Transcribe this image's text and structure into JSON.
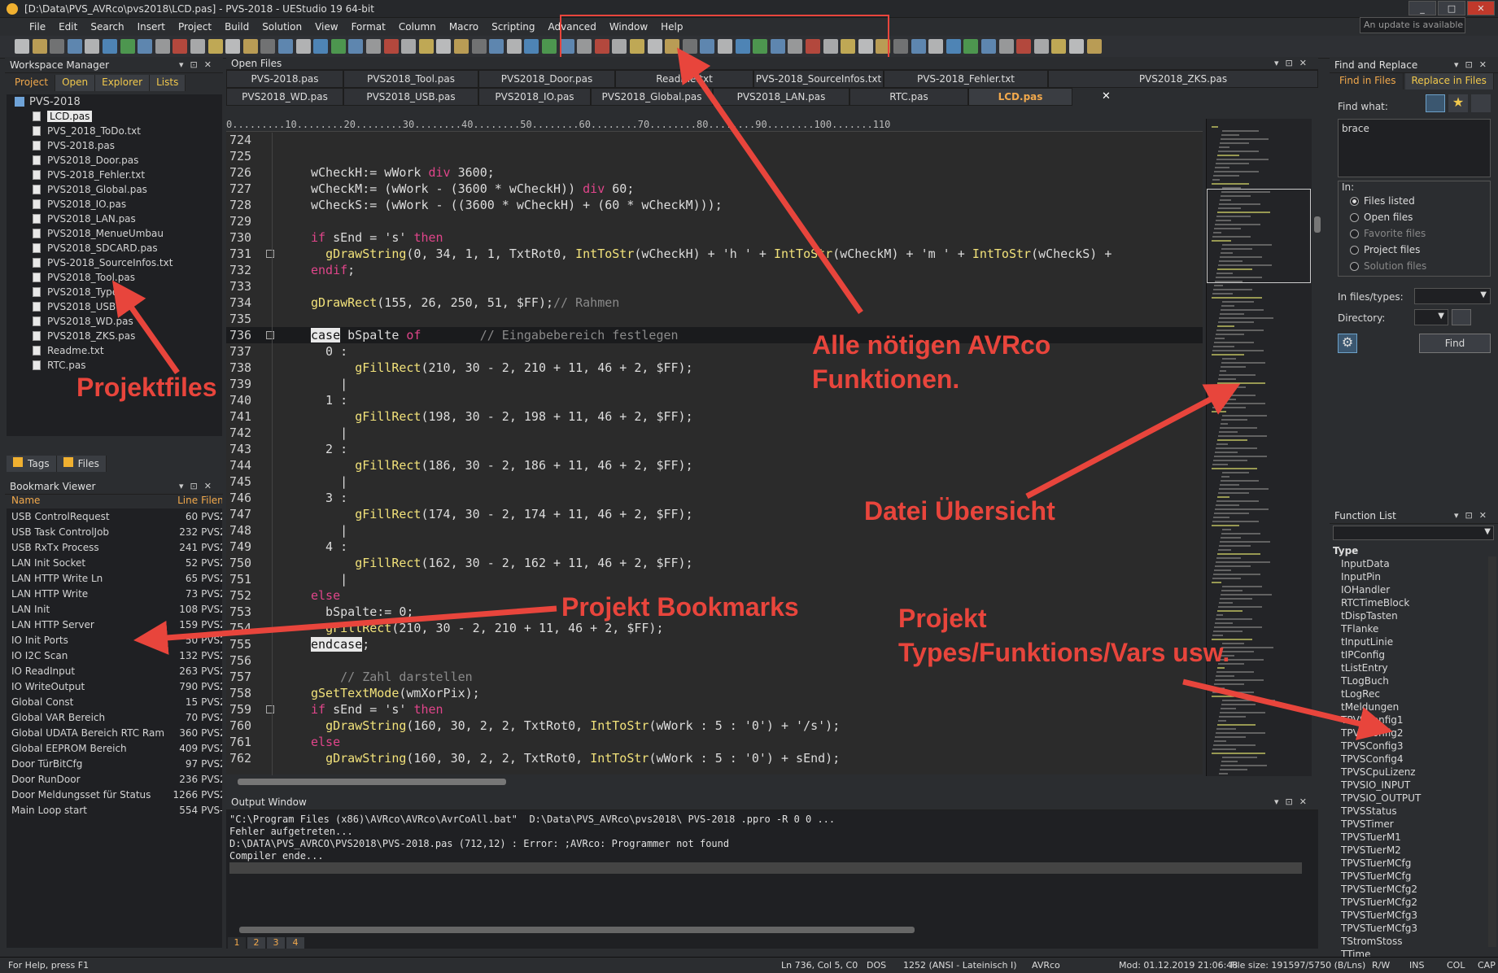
{
  "window": {
    "title": "[D:\\Data\\PVS_AVRco\\pvs2018\\LCD.pas] - PVS-2018 - UEStudio 19 64-bit",
    "update_note": "An update is available"
  },
  "menu": [
    "File",
    "Edit",
    "Search",
    "Insert",
    "Project",
    "Build",
    "Solution",
    "View",
    "Format",
    "Column",
    "Macro",
    "Scripting",
    "Advanced",
    "Window",
    "Help"
  ],
  "workspace": {
    "title": "Workspace Manager",
    "tabs": [
      "Project",
      "Open",
      "Explorer",
      "Lists"
    ],
    "root": "PVS-2018",
    "files": [
      "LCD.pas",
      "PVS_2018_ToDo.txt",
      "PVS-2018.pas",
      "PVS2018_Door.pas",
      "PVS-2018_Fehler.txt",
      "PVS2018_Global.pas",
      "PVS2018_IO.pas",
      "PVS2018_LAN.pas",
      "PVS2018_MenueUmbau",
      "PVS2018_SDCARD.pas",
      "PVS-2018_SourceInfos.txt",
      "PVS2018_Tool.pas",
      "PVS2018_Type.p",
      "PVS2018_USB.pa",
      "PVS2018_WD.pas",
      "PVS2018_ZKS.pas",
      "Readme.txt",
      "RTC.pas"
    ],
    "bottom_tabs": [
      "Tags",
      "Files"
    ]
  },
  "bookmarks": {
    "title": "Bookmark Viewer",
    "col_name": "Name",
    "col_line": "Line",
    "col_file": "Filena",
    "rows": [
      {
        "name": "USB ControlRequest",
        "line": "60",
        "file": "PVS2"
      },
      {
        "name": "USB Task ControlJob",
        "line": "232",
        "file": "PVS2"
      },
      {
        "name": "USB RxTx Process",
        "line": "241",
        "file": "PVS2"
      },
      {
        "name": "LAN Init Socket",
        "line": "52",
        "file": "PVS2"
      },
      {
        "name": "LAN HTTP Write Ln",
        "line": "65",
        "file": "PVS2"
      },
      {
        "name": "LAN HTTP Write",
        "line": "73",
        "file": "PVS2"
      },
      {
        "name": "LAN Init",
        "line": "108",
        "file": "PVS2"
      },
      {
        "name": "LAN HTTP Server",
        "line": "159",
        "file": "PVS2"
      },
      {
        "name": "IO Init Ports",
        "line": "50",
        "file": "PVS2"
      },
      {
        "name": "IO I2C Scan",
        "line": "132",
        "file": "PVS2"
      },
      {
        "name": "IO ReadInput",
        "line": "263",
        "file": "PVS2"
      },
      {
        "name": "IO WriteOutput",
        "line": "790",
        "file": "PVS2"
      },
      {
        "name": "Global Const",
        "line": "15",
        "file": "PVS2"
      },
      {
        "name": "Global VAR Bereich",
        "line": "70",
        "file": "PVS2"
      },
      {
        "name": "Global UDATA Bereich RTC Ram",
        "line": "360",
        "file": "PVS2"
      },
      {
        "name": "Global EEPROM Bereich",
        "line": "409",
        "file": "PVS2"
      },
      {
        "name": "Door TürBitCfg",
        "line": "97",
        "file": "PVS2"
      },
      {
        "name": "Door RunDoor",
        "line": "236",
        "file": "PVS2"
      },
      {
        "name": "Door Meldungsset für Status",
        "line": "1266",
        "file": "PVS2"
      },
      {
        "name": "Main Loop start",
        "line": "554",
        "file": "PVS-"
      }
    ]
  },
  "open_files": {
    "title": "Open Files",
    "row1": [
      "PVS-2018.pas",
      "PVS2018_Tool.pas",
      "PVS2018_Door.pas",
      "Readme.txt",
      "PVS-2018_SourceInfos.txt",
      "PVS-2018_Fehler.txt",
      "PVS2018_ZKS.pas"
    ],
    "row2": [
      "PVS2018_WD.pas",
      "PVS2018_USB.pas",
      "PVS2018_IO.pas",
      "PVS2018_Global.pas",
      "PVS2018_LAN.pas",
      "RTC.pas",
      "LCD.pas"
    ]
  },
  "ruler": "0.........10........20........30........40........50........60........70........80........90........100.......110",
  "code_lines": [
    {
      "n": "724",
      "h": ""
    },
    {
      "n": "725",
      "h": ""
    },
    {
      "n": "726",
      "h": "wCheckH:= wWork <span class='kw'>div</span> 3600;"
    },
    {
      "n": "727",
      "h": "wCheckM:= (wWork - (3600 * wCheckH)) <span class='kw'>div</span> 60;"
    },
    {
      "n": "728",
      "h": "wCheckS:= (wWork - ((3600 * wCheckH) + (60 * wCheckM)));"
    },
    {
      "n": "729",
      "h": ""
    },
    {
      "n": "730",
      "h": "<span class='kw'>if</span> sEnd = 's' <span class='kw'>then</span>"
    },
    {
      "n": "731",
      "h": "  <span class='fn'>gDrawString</span>(0, 34, 1, 1, TxtRot0, <span class='fn'>IntToStr</span>(wCheckH) + 'h ' + <span class='fn'>IntToStr</span>(wCheckM) + 'm ' + <span class='fn'>IntToStr</span>(wCheckS) +"
    },
    {
      "n": "732",
      "h": "<span class='kw'>endif</span>;"
    },
    {
      "n": "733",
      "h": ""
    },
    {
      "n": "734",
      "h": "<span class='fn'>gDrawRect</span>(155, 26, 250, 51, $FF);<span class='cm'>// Rahmen</span>"
    },
    {
      "n": "735",
      "h": ""
    },
    {
      "n": "736",
      "h": "<span class='hl'>case</span> bSpalte <span class='kw'>of</span>        <span class='cm'>// Eingabebereich festlegen</span>"
    },
    {
      "n": "737",
      "h": "  0 :"
    },
    {
      "n": "738",
      "h": "      <span class='fn'>gFillRect</span>(210, 30 - 2, 210 + 11, 46 + 2, $FF);"
    },
    {
      "n": "739",
      "h": "    |"
    },
    {
      "n": "740",
      "h": "  1 :"
    },
    {
      "n": "741",
      "h": "      <span class='fn'>gFillRect</span>(198, 30 - 2, 198 + 11, 46 + 2, $FF);"
    },
    {
      "n": "742",
      "h": "    |"
    },
    {
      "n": "743",
      "h": "  2 :"
    },
    {
      "n": "744",
      "h": "      <span class='fn'>gFillRect</span>(186, 30 - 2, 186 + 11, 46 + 2, $FF);"
    },
    {
      "n": "745",
      "h": "    |"
    },
    {
      "n": "746",
      "h": "  3 :"
    },
    {
      "n": "747",
      "h": "      <span class='fn'>gFillRect</span>(174, 30 - 2, 174 + 11, 46 + 2, $FF);"
    },
    {
      "n": "748",
      "h": "    |"
    },
    {
      "n": "749",
      "h": "  4 :"
    },
    {
      "n": "750",
      "h": "      <span class='fn'>gFillRect</span>(162, 30 - 2, 162 + 11, 46 + 2, $FF);"
    },
    {
      "n": "751",
      "h": "    |"
    },
    {
      "n": "752",
      "h": "<span class='kw'>else</span>"
    },
    {
      "n": "753",
      "h": "  bSpalte:= 0;"
    },
    {
      "n": "754",
      "h": "  <span class='fn'>gFillRect</span>(210, 30 - 2, 210 + 11, 46 + 2, $FF);"
    },
    {
      "n": "755",
      "h": "<span class='hl'>endcase</span>;"
    },
    {
      "n": "756",
      "h": ""
    },
    {
      "n": "757",
      "h": "    <span class='cm'>// Zahl darstellen</span>"
    },
    {
      "n": "758",
      "h": "<span class='fn'>gSetTextMode</span>(wmXorPix);"
    },
    {
      "n": "759",
      "h": "<span class='kw'>if</span> sEnd = 's' <span class='kw'>then</span>"
    },
    {
      "n": "760",
      "h": "  <span class='fn'>gDrawString</span>(160, 30, 2, 2, TxtRot0, <span class='fn'>IntToStr</span>(wWork : 5 : '0') + '/s');"
    },
    {
      "n": "761",
      "h": "<span class='kw'>else</span>"
    },
    {
      "n": "762",
      "h": "  <span class='fn'>gDrawString</span>(160, 30, 2, 2, TxtRot0, <span class='fn'>IntToStr</span>(wWork : 5 : '0') + sEnd);"
    }
  ],
  "output": {
    "title": "Output Window",
    "lines": [
      "\"C:\\Program Files (x86)\\AVRco\\AVRco\\AvrCoAll.bat\"  D:\\Data\\PVS_AVRco\\pvs2018\\ PVS-2018 .ppro -R 0 0 ...",
      "Fehler aufgetreten...",
      "D:\\DATA\\PVS_AVRCO\\PVS2018\\PVS-2018.pas (712,12) : Error: ;AVRco: Programmer not found",
      "Compiler ende..."
    ],
    "tabs": [
      "1",
      "2",
      "3",
      "4"
    ]
  },
  "find": {
    "title": "Find and Replace",
    "tab1": "Find in Files",
    "tab2": "Replace in Files",
    "what_label": "Find what:",
    "what_value": "brace",
    "in_label": "In:",
    "options": [
      "Files listed",
      "Open files",
      "Favorite files",
      "Project files",
      "Solution files"
    ],
    "types_label": "In files/types:",
    "dir_label": "Directory:",
    "find_btn": "Find"
  },
  "functions": {
    "title": "Function List",
    "type_label": "Type",
    "items": [
      "InputData",
      "InputPin",
      "IOHandler",
      "RTCTimeBlock",
      "tDispTasten",
      "TFlanke",
      "tInputLinie",
      "tIPConfig",
      "tListEntry",
      "TLogBuch",
      "tLogRec",
      "tMeldungen",
      "TPVSConfig1",
      "TPVSConfig2",
      "TPVSConfig3",
      "TPVSConfig4",
      "TPVSCpuLizenz",
      "TPVSIO_INPUT",
      "TPVSIO_OUTPUT",
      "TPVSStatus",
      "TPVSTimer",
      "TPVSTuerM1",
      "TPVSTuerM2",
      "TPVSTuerMCfg",
      "TPVSTuerMCfg",
      "TPVSTuerMCfg2",
      "TPVSTuerMCfg2",
      "TPVSTuerMCfg3",
      "TPVSTuerMCfg3",
      "TStromStoss",
      "TTime"
    ]
  },
  "status": {
    "help": "For Help, press F1",
    "pos": "Ln 736, Col 5, C0",
    "eol": "DOS",
    "enc": "1252  (ANSI - Lateinisch I)",
    "lang": "AVRco",
    "mod": "Mod: 01.12.2019 21:06:48",
    "size": "File size: 191597/5750 (B/Lns)",
    "rw": "R/W",
    "ins": "INS",
    "col": "COL",
    "cap": "CAP"
  },
  "annotations": {
    "funcs1": "Alle nötigen AVRco",
    "funcs2": "Funktionen.",
    "projfiles": "Projektfiles",
    "overview": "Datei Übersicht",
    "bookmarks": "Projekt Bookmarks",
    "types1": "Projekt",
    "types2": "Types/Funktions/Vars usw."
  },
  "colors": {
    "annotation": "#e8453c",
    "keyword": "#e0458a",
    "function": "#f2e27a",
    "comment": "#8a8a8a"
  }
}
